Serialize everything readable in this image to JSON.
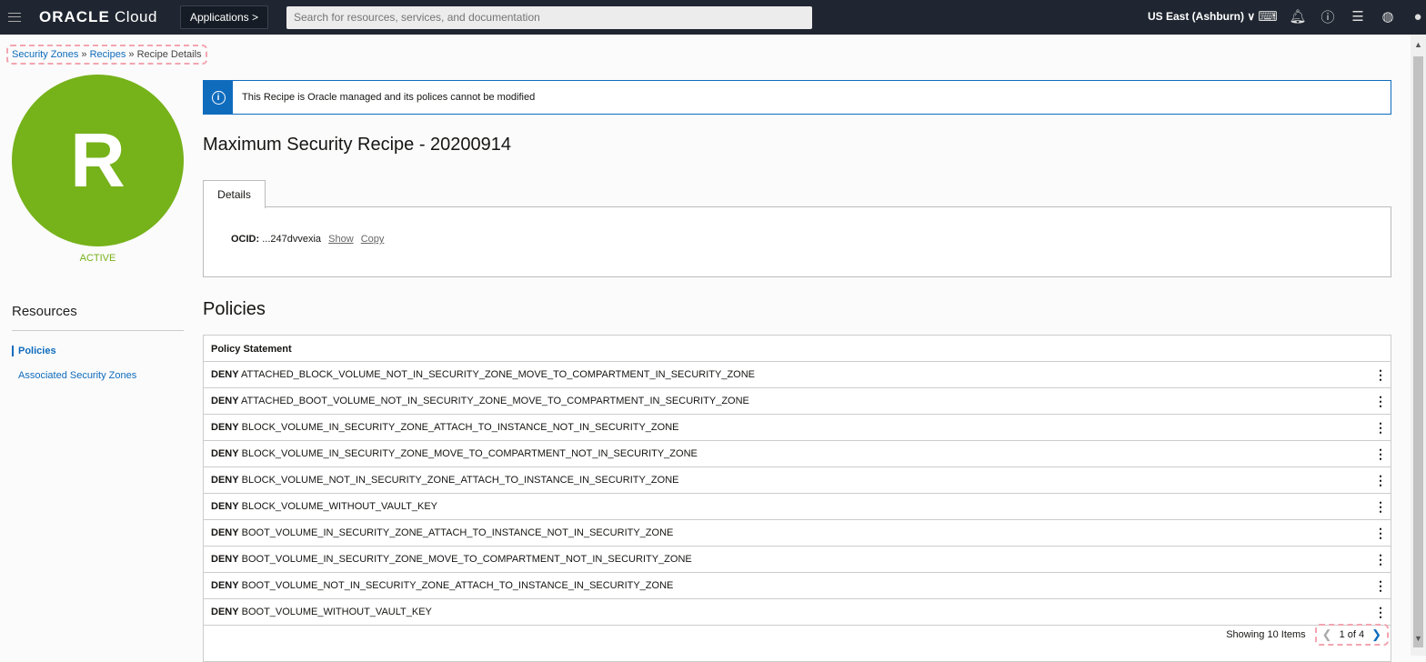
{
  "topbar": {
    "logo_brand": "ORACLE",
    "logo_product": "Cloud",
    "applications": "Applications >",
    "search_placeholder": "Search for resources, services, and documentation",
    "region": "US East (Ashburn) ∨",
    "icons": [
      "cloud-shell-icon",
      "notifications-icon",
      "help-icon",
      "feedback-icon",
      "language-icon",
      "profile-icon"
    ]
  },
  "breadcrumb": {
    "items": [
      "Security Zones",
      "Recipes"
    ],
    "current": "Recipe Details",
    "sep": " » "
  },
  "recipe": {
    "avatar_letter": "R",
    "status": "ACTIVE",
    "title": "Maximum Security Recipe - 20200914",
    "accent": "#76b21a"
  },
  "info": {
    "text": "This Recipe is Oracle managed and its polices cannot be modified"
  },
  "details": {
    "tab": "Details",
    "ocid_label": "OCID:",
    "ocid_value": "...247dvvexia",
    "show": "Show",
    "copy": "Copy"
  },
  "resources": {
    "title": "Resources",
    "items": [
      "Policies",
      "Associated Security Zones"
    ]
  },
  "policies": {
    "title": "Policies",
    "column": "Policy Statement",
    "rows": [
      {
        "action": "DENY",
        "name": "ATTACHED_BLOCK_VOLUME_NOT_IN_SECURITY_ZONE_MOVE_TO_COMPARTMENT_IN_SECURITY_ZONE"
      },
      {
        "action": "DENY",
        "name": "ATTACHED_BOOT_VOLUME_NOT_IN_SECURITY_ZONE_MOVE_TO_COMPARTMENT_IN_SECURITY_ZONE"
      },
      {
        "action": "DENY",
        "name": "BLOCK_VOLUME_IN_SECURITY_ZONE_ATTACH_TO_INSTANCE_NOT_IN_SECURITY_ZONE"
      },
      {
        "action": "DENY",
        "name": "BLOCK_VOLUME_IN_SECURITY_ZONE_MOVE_TO_COMPARTMENT_NOT_IN_SECURITY_ZONE"
      },
      {
        "action": "DENY",
        "name": "BLOCK_VOLUME_NOT_IN_SECURITY_ZONE_ATTACH_TO_INSTANCE_IN_SECURITY_ZONE"
      },
      {
        "action": "DENY",
        "name": "BLOCK_VOLUME_WITHOUT_VAULT_KEY"
      },
      {
        "action": "DENY",
        "name": "BOOT_VOLUME_IN_SECURITY_ZONE_ATTACH_TO_INSTANCE_NOT_IN_SECURITY_ZONE"
      },
      {
        "action": "DENY",
        "name": "BOOT_VOLUME_IN_SECURITY_ZONE_MOVE_TO_COMPARTMENT_NOT_IN_SECURITY_ZONE"
      },
      {
        "action": "DENY",
        "name": "BOOT_VOLUME_NOT_IN_SECURITY_ZONE_ATTACH_TO_INSTANCE_IN_SECURITY_ZONE"
      },
      {
        "action": "DENY",
        "name": "BOOT_VOLUME_WITHOUT_VAULT_KEY"
      }
    ],
    "showing": "Showing 10 Items",
    "page": "1 of 4"
  }
}
